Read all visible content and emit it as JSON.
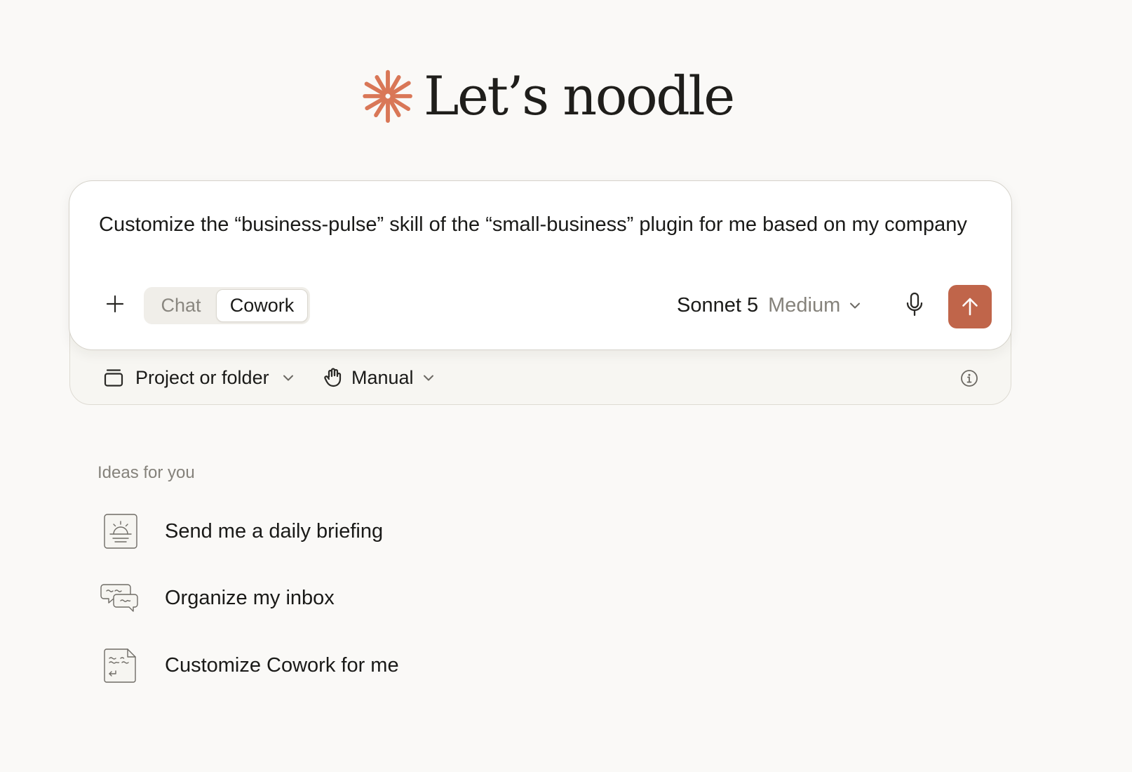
{
  "greeting": {
    "title": "Let’s noodle",
    "logo_icon": "sparkle-logo-icon",
    "accent_color": "#d97757"
  },
  "composer": {
    "prompt_text": "Customize the “business-pulse” skill of the “small-business” plugin for me based on my company",
    "add_icon": "plus-icon",
    "mode_tabs": [
      {
        "label": "Chat",
        "selected": false
      },
      {
        "label": "Cowork",
        "selected": true
      }
    ],
    "model": {
      "name": "Sonnet 5",
      "effort": "Medium",
      "chevron_icon": "chevron-down-icon"
    },
    "mic_icon": "microphone-icon",
    "send_icon": "arrow-up-icon",
    "send_color": "#c0654a"
  },
  "options": {
    "project": {
      "label": "Project or folder",
      "icon": "folder-icon"
    },
    "permission": {
      "label": "Manual",
      "icon": "hand-icon"
    },
    "info_icon": "info-icon"
  },
  "ideas": {
    "heading": "Ideas for you",
    "items": [
      {
        "label": "Send me a daily briefing",
        "icon": "sunrise-card-icon"
      },
      {
        "label": "Organize my inbox",
        "icon": "chat-bubbles-icon"
      },
      {
        "label": "Customize Cowork for me",
        "icon": "document-icon"
      }
    ]
  }
}
